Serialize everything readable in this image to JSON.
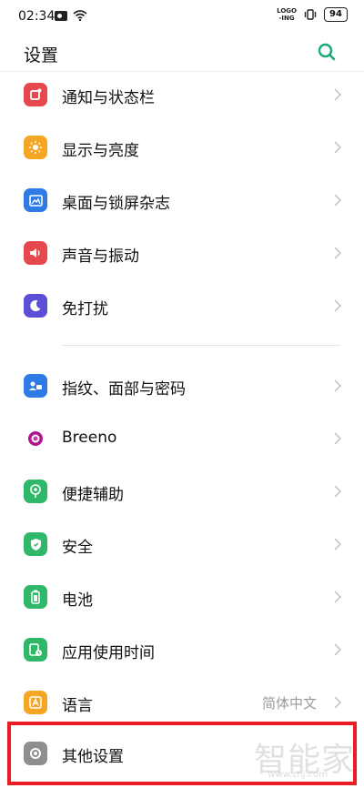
{
  "status_bar": {
    "time": "02:34",
    "logo_line1": "LOGO",
    "logo_line2": "-ING",
    "battery": "94"
  },
  "header": {
    "title": "设置",
    "search_icon": "search-icon"
  },
  "group1": [
    {
      "label": "通知与状态栏",
      "icon": "notification-icon",
      "color": "#e5484d"
    },
    {
      "label": "显示与亮度",
      "icon": "brightness-icon",
      "color": "#f5a623"
    },
    {
      "label": "桌面与锁屏杂志",
      "icon": "wallpaper-icon",
      "color": "#2f7be5"
    },
    {
      "label": "声音与振动",
      "icon": "sound-icon",
      "color": "#e5484d"
    },
    {
      "label": "免打扰",
      "icon": "moon-icon",
      "color": "#5b4fd6"
    }
  ],
  "group2": [
    {
      "label": "指纹、面部与密码",
      "icon": "fingerprint-icon",
      "color": "#2f7be5"
    },
    {
      "label": "Breeno",
      "icon": "breeno-icon",
      "color": "#b2168f"
    },
    {
      "label": "便捷辅助",
      "icon": "assist-icon",
      "color": "#2fb86a"
    },
    {
      "label": "安全",
      "icon": "shield-icon",
      "color": "#2fb86a"
    },
    {
      "label": "电池",
      "icon": "battery-icon",
      "color": "#2fb86a"
    },
    {
      "label": "应用使用时间",
      "icon": "app-time-icon",
      "color": "#2fb86a"
    },
    {
      "label": "语言",
      "value": "简体中文",
      "icon": "language-icon",
      "color": "#f5a623"
    },
    {
      "label": "其他设置",
      "icon": "other-settings-icon",
      "color": "#8e8e8e"
    }
  ],
  "watermark": {
    "text": "智能家",
    "url": "www.znj.com"
  },
  "colors": {
    "accent": "#19a974",
    "highlight": "#ea1c24"
  }
}
